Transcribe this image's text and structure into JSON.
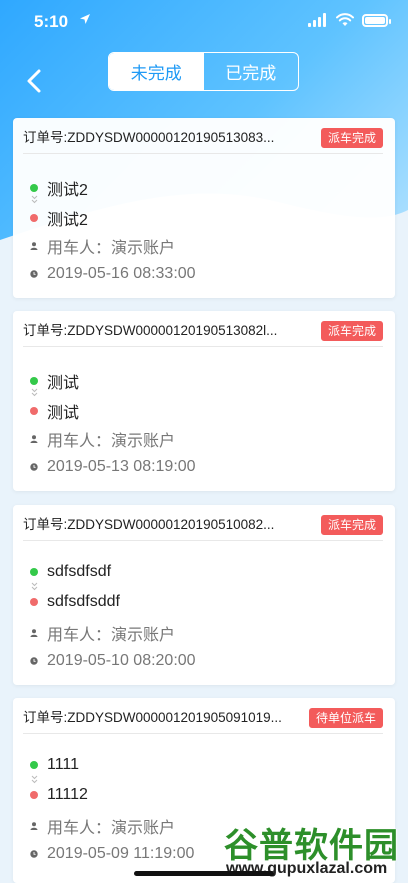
{
  "status": {
    "time": "5:10"
  },
  "nav": {
    "tabs": [
      {
        "label": "未完成",
        "active": true
      },
      {
        "label": "已完成",
        "active": false
      }
    ]
  },
  "orders": [
    {
      "order_no": "订单号:ZDDYSDW00000120190513083...",
      "status": "派车完成",
      "from": "测试2",
      "to": "测试2",
      "user": "用车人：演示账户",
      "time": "2019-05-16 08:33:00"
    },
    {
      "order_no": "订单号:ZDDYSDW00000120190513082l...",
      "status": "派车完成",
      "from": "测试",
      "to": "测试",
      "user": "用车人：演示账户",
      "time": "2019-05-13 08:19:00"
    },
    {
      "order_no": "订单号:ZDDYSDW00000120190510082...",
      "status": "派车完成",
      "from": "sdfsdfsdf",
      "to": "sdfsdfsddf",
      "user": "用车人：演示账户",
      "time": "2019-05-10 08:20:00"
    },
    {
      "order_no": "订单号:ZDDYSDW000001201905091019...",
      "status": "待单位派车",
      "from": "1111",
      "to": "11112",
      "user": "用车人：演示账户",
      "time": "2019-05-09 11:19:00"
    }
  ],
  "watermark": {
    "title": "谷普软件园",
    "url": "www.gupuxlazal.com"
  },
  "colors": {
    "accent": "#1f9af5",
    "tag": "#f35b5b",
    "from_dot": "#34c94a",
    "to_dot": "#f06b6b"
  }
}
